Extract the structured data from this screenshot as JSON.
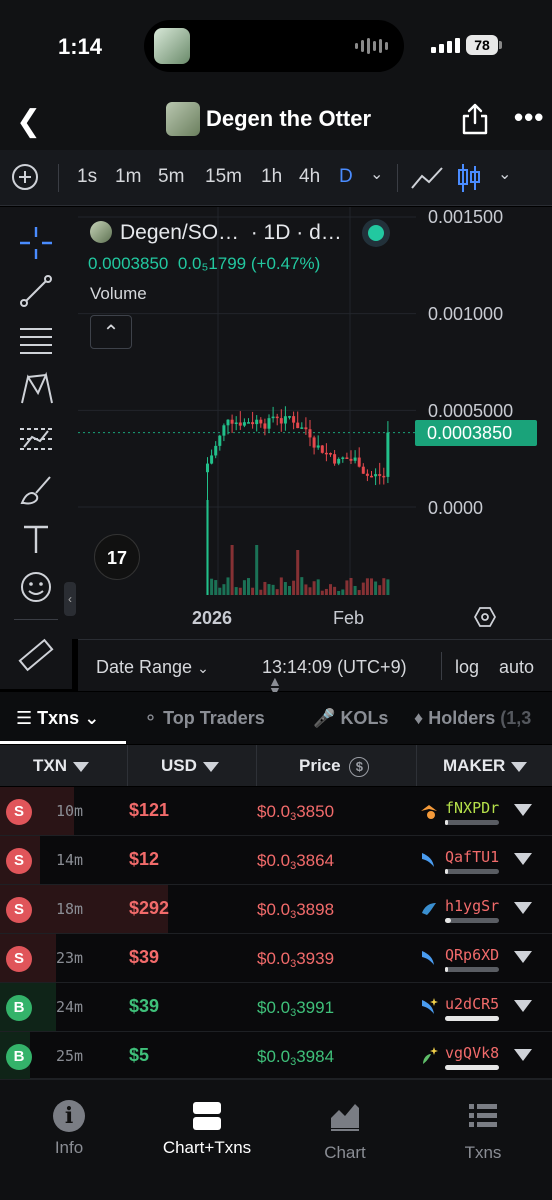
{
  "status_bar": {
    "time": "1:14",
    "battery": "78"
  },
  "header": {
    "title": "Degen the Otter"
  },
  "toolbar": {
    "intervals": [
      "1s",
      "1m",
      "5m",
      "15m",
      "1h",
      "4h",
      "D"
    ],
    "active_interval": "D"
  },
  "chart": {
    "legend_title": "Degen/SO…",
    "legend_meta": "· 1D · d…",
    "legend_price": "0.0003850",
    "legend_change": "0.0₅1799 (+0.47%)",
    "volume_label": "Volume",
    "price_ticks": [
      "0.001500",
      "0.001000",
      "0.0005000",
      "0.0000"
    ],
    "last_price": "0.0003850",
    "x_labels": [
      "2026",
      "Feb"
    ],
    "tv_logo": "17"
  },
  "chart_data": {
    "type": "candlestick",
    "ylim": [
      0,
      0.0015
    ],
    "last_price": 0.000385,
    "interval": "1D"
  },
  "range_bar": {
    "date_range": "Date Range",
    "clock": "13:14:09 (UTC+9)",
    "log": "log",
    "auto": "auto"
  },
  "tabs": [
    {
      "label": "Txns",
      "active": true
    },
    {
      "label": "Top Traders",
      "active": false
    },
    {
      "label": "KOLs",
      "active": false
    },
    {
      "label": "Holders",
      "active": false
    },
    {
      "label": "(1,3",
      "active": false
    }
  ],
  "table": {
    "headers": [
      "TXN",
      "USD",
      "Price",
      "MAKER"
    ],
    "rows": [
      {
        "side": "S",
        "age": "10m",
        "usd": "$121",
        "price_pre": "$0.0",
        "price_sub": "3",
        "price_post": "3850",
        "maker": "fNXPDr",
        "maker_color": "#b5e04a",
        "maker_fill": 0.05
      },
      {
        "side": "S",
        "age": "14m",
        "usd": "$12",
        "price_pre": "$0.0",
        "price_sub": "3",
        "price_post": "3864",
        "maker": "QafTU1",
        "maker_color": "#f26b6b",
        "maker_fill": 0.05
      },
      {
        "side": "S",
        "age": "18m",
        "usd": "$292",
        "price_pre": "$0.0",
        "price_sub": "3",
        "price_post": "3898",
        "maker": "h1ygSr",
        "maker_color": "#f26b6b",
        "maker_fill": 0.12
      },
      {
        "side": "S",
        "age": "23m",
        "usd": "$39",
        "price_pre": "$0.0",
        "price_sub": "3",
        "price_post": "3939",
        "maker": "QRp6XD",
        "maker_color": "#f26b6b",
        "maker_fill": 0.05
      },
      {
        "side": "B",
        "age": "24m",
        "usd": "$39",
        "price_pre": "$0.0",
        "price_sub": "3",
        "price_post": "3991",
        "maker": "u2dCR5",
        "maker_color": "#f26b6b",
        "maker_fill": 1.0
      },
      {
        "side": "B",
        "age": "25m",
        "usd": "$5",
        "price_pre": "$0.0",
        "price_sub": "3",
        "price_post": "3984",
        "maker": "vgQVk8",
        "maker_color": "#f26b6b",
        "maker_fill": 1.0
      }
    ]
  },
  "bottom_nav": [
    {
      "label": "Info",
      "icon": "info-icon",
      "active": false
    },
    {
      "label": "Chart+Txns",
      "icon": "split-view-icon",
      "active": true
    },
    {
      "label": "Chart",
      "icon": "chart-area-icon",
      "active": false
    },
    {
      "label": "Txns",
      "icon": "list-icon",
      "active": false
    }
  ],
  "colors": {
    "sell": "#f26b6b",
    "buy": "#3fc07a",
    "accent": "#22c8a0",
    "active_blue": "#4a8cff"
  }
}
